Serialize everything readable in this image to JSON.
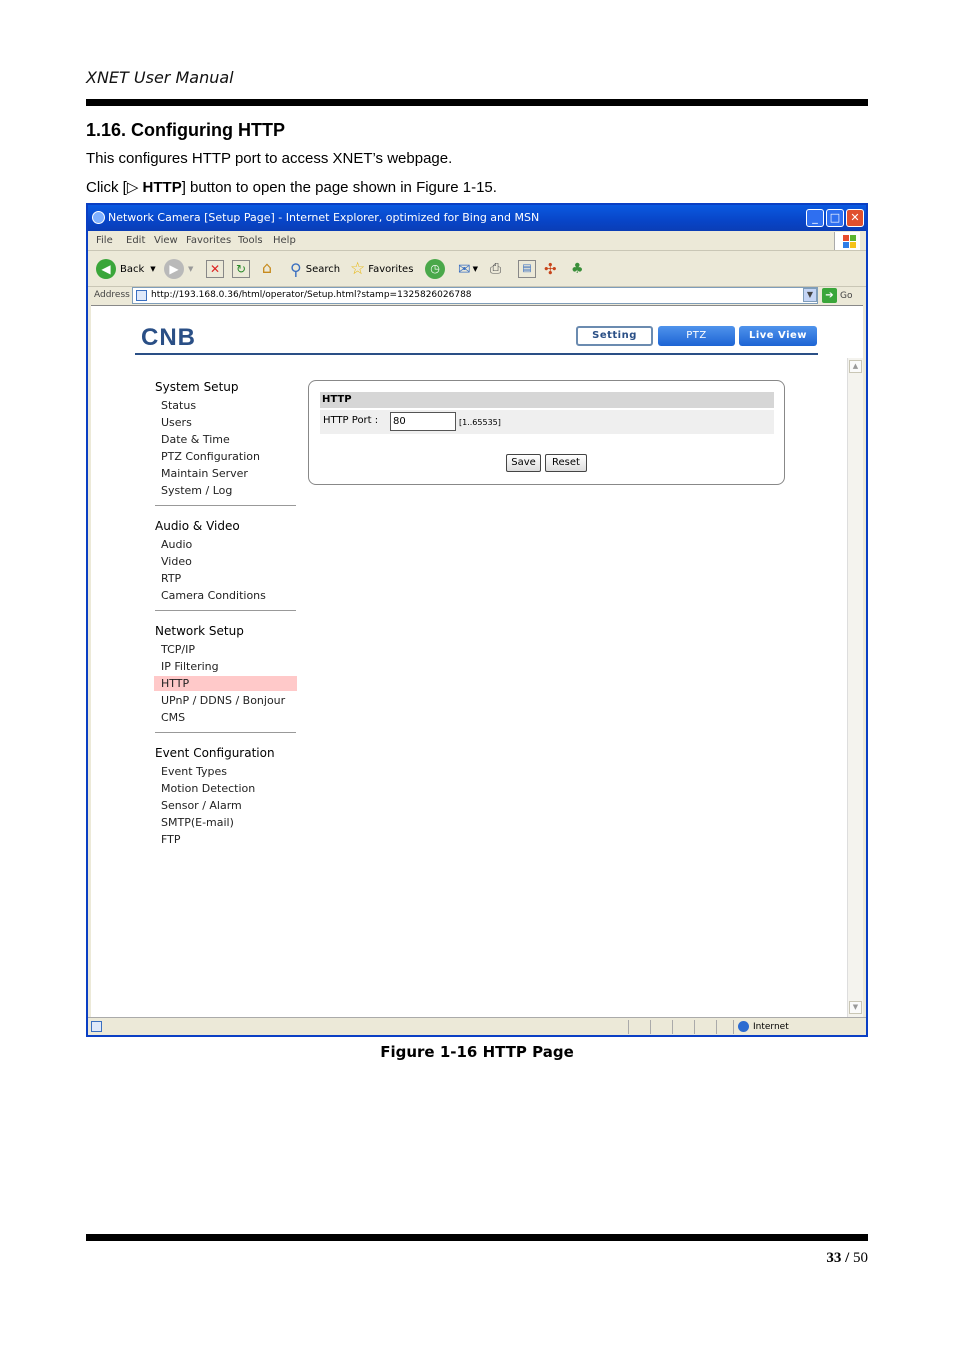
{
  "doc": {
    "header": "XNET User Manual",
    "section_title": "1.16. Configuring HTTP",
    "para1": "This configures HTTP port to access XNET’s webpage.",
    "para2_prefix": "Click [▷ ",
    "para2_bold": "HTTP",
    "para2_suffix": "] button to open the page shown in Figure 1-15.",
    "caption": "Figure 1-16 HTTP Page",
    "page_current": "33",
    "page_sep": " / ",
    "page_total": "50"
  },
  "browser": {
    "title": "Network Camera [Setup Page] - Internet Explorer, optimized for Bing and MSN",
    "menu": [
      "File",
      "Edit",
      "View",
      "Favorites",
      "Tools",
      "Help"
    ],
    "toolbar": {
      "back": "Back",
      "search": "Search",
      "favorites": "Favorites"
    },
    "address_label": "Address",
    "address_url": "http://193.168.0.36/html/operator/Setup.html?stamp=1325826026788",
    "go": "Go",
    "status_zone": "Internet"
  },
  "camera": {
    "logo": "CNB",
    "nav": {
      "setting": "Setting",
      "ptz": "PTZ",
      "live": "Live View"
    },
    "groups": [
      {
        "title": "System Setup",
        "items": [
          "Status",
          "Users",
          "Date & Time",
          "PTZ Configuration",
          "Maintain Server",
          "System / Log"
        ]
      },
      {
        "title": "Audio & Video",
        "items": [
          "Audio",
          "Video",
          "RTP",
          "Camera Conditions"
        ]
      },
      {
        "title": "Network Setup",
        "items": [
          "TCP/IP",
          "IP Filtering",
          "HTTP",
          "UPnP / DDNS / Bonjour",
          "CMS"
        ]
      },
      {
        "title": "Event Configuration",
        "items": [
          "Event Types",
          "Motion Detection",
          "Sensor / Alarm",
          "SMTP(E-mail)",
          "FTP"
        ]
      }
    ],
    "panel": {
      "title": "HTTP",
      "port_label": "HTTP Port :",
      "port_value": "80",
      "port_range": "[1..65535]",
      "save": "Save",
      "reset": "Reset"
    }
  }
}
